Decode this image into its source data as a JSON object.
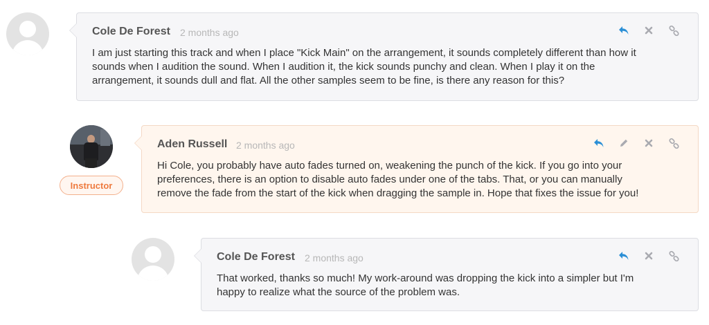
{
  "colors": {
    "reply": "#2b8fd6",
    "icon_gray": "#a9aab0",
    "instructor": "#ee7a3e"
  },
  "comments": [
    {
      "author": "Cole De Forest",
      "time": "2 months ago",
      "text": [
        "I am just starting this track and when I place \"Kick Main\" on the arrangement, it sounds completely different than how it",
        "sounds when I audition the sound. When I audition it, the kick sounds punchy and clean. When I play it on the",
        "arrangement, it sounds dull and flat. All the other samples seem to be fine, is there any reason for this?"
      ],
      "actions": [
        "reply-icon",
        "close-icon",
        "link-icon"
      ]
    },
    {
      "author": "Aden Russell",
      "time": "2 months ago",
      "badge": "Instructor",
      "text": [
        "Hi Cole, you probably have auto fades turned on, weakening the punch of the kick. If you go into your",
        "preferences, there is an option to disable auto fades under one of the tabs. That, or you can manually",
        "remove the fade from the start of the kick when dragging the sample in. Hope that fixes the issue for you!"
      ],
      "actions": [
        "reply-icon",
        "pencil-icon",
        "close-icon",
        "link-icon"
      ]
    },
    {
      "author": "Cole De Forest",
      "time": "2 months ago",
      "text": [
        "That worked, thanks so much! My work-around was dropping the kick into a simpler but I'm",
        "happy to realize what the source of the problem was."
      ],
      "actions": [
        "reply-icon",
        "close-icon",
        "link-icon"
      ]
    }
  ]
}
